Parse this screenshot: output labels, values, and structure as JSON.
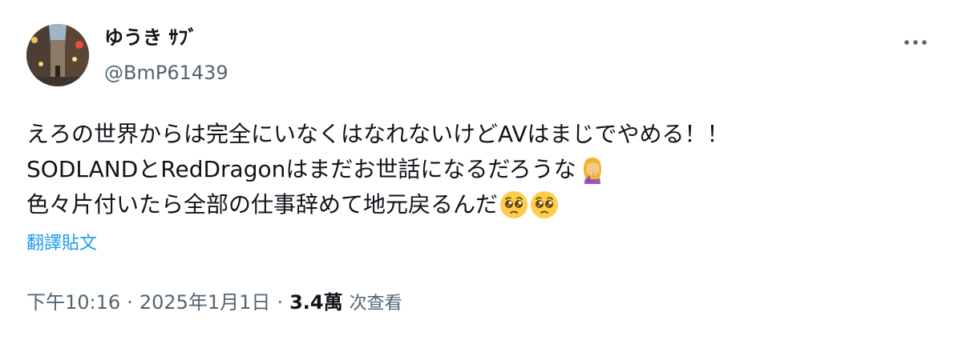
{
  "author": {
    "display_name": "ゆうき ｻﾌﾞ",
    "handle": "@BmP61439"
  },
  "tweet": {
    "lines": [
      "えろの世界からは完全にいなくはなれないけどAVはまじでやめる！！",
      "SODLANDとRedDragonはまだお世話になるだろうな",
      "色々片付いたら全部の仕事辞めて地元戻るんだ"
    ],
    "emojis": [
      "woman-facepalming-icon",
      "pleading-face-icon",
      "pleading-face-icon"
    ]
  },
  "translate_label": "翻譯貼文",
  "meta": {
    "time": "下午10:16",
    "separator": "·",
    "date": "2025年1月1日",
    "views_count": "3.4萬",
    "views_label": "次查看"
  },
  "colors": {
    "link": "#1d9bf0",
    "secondary_text": "#536471",
    "primary_text": "#0f1419"
  }
}
